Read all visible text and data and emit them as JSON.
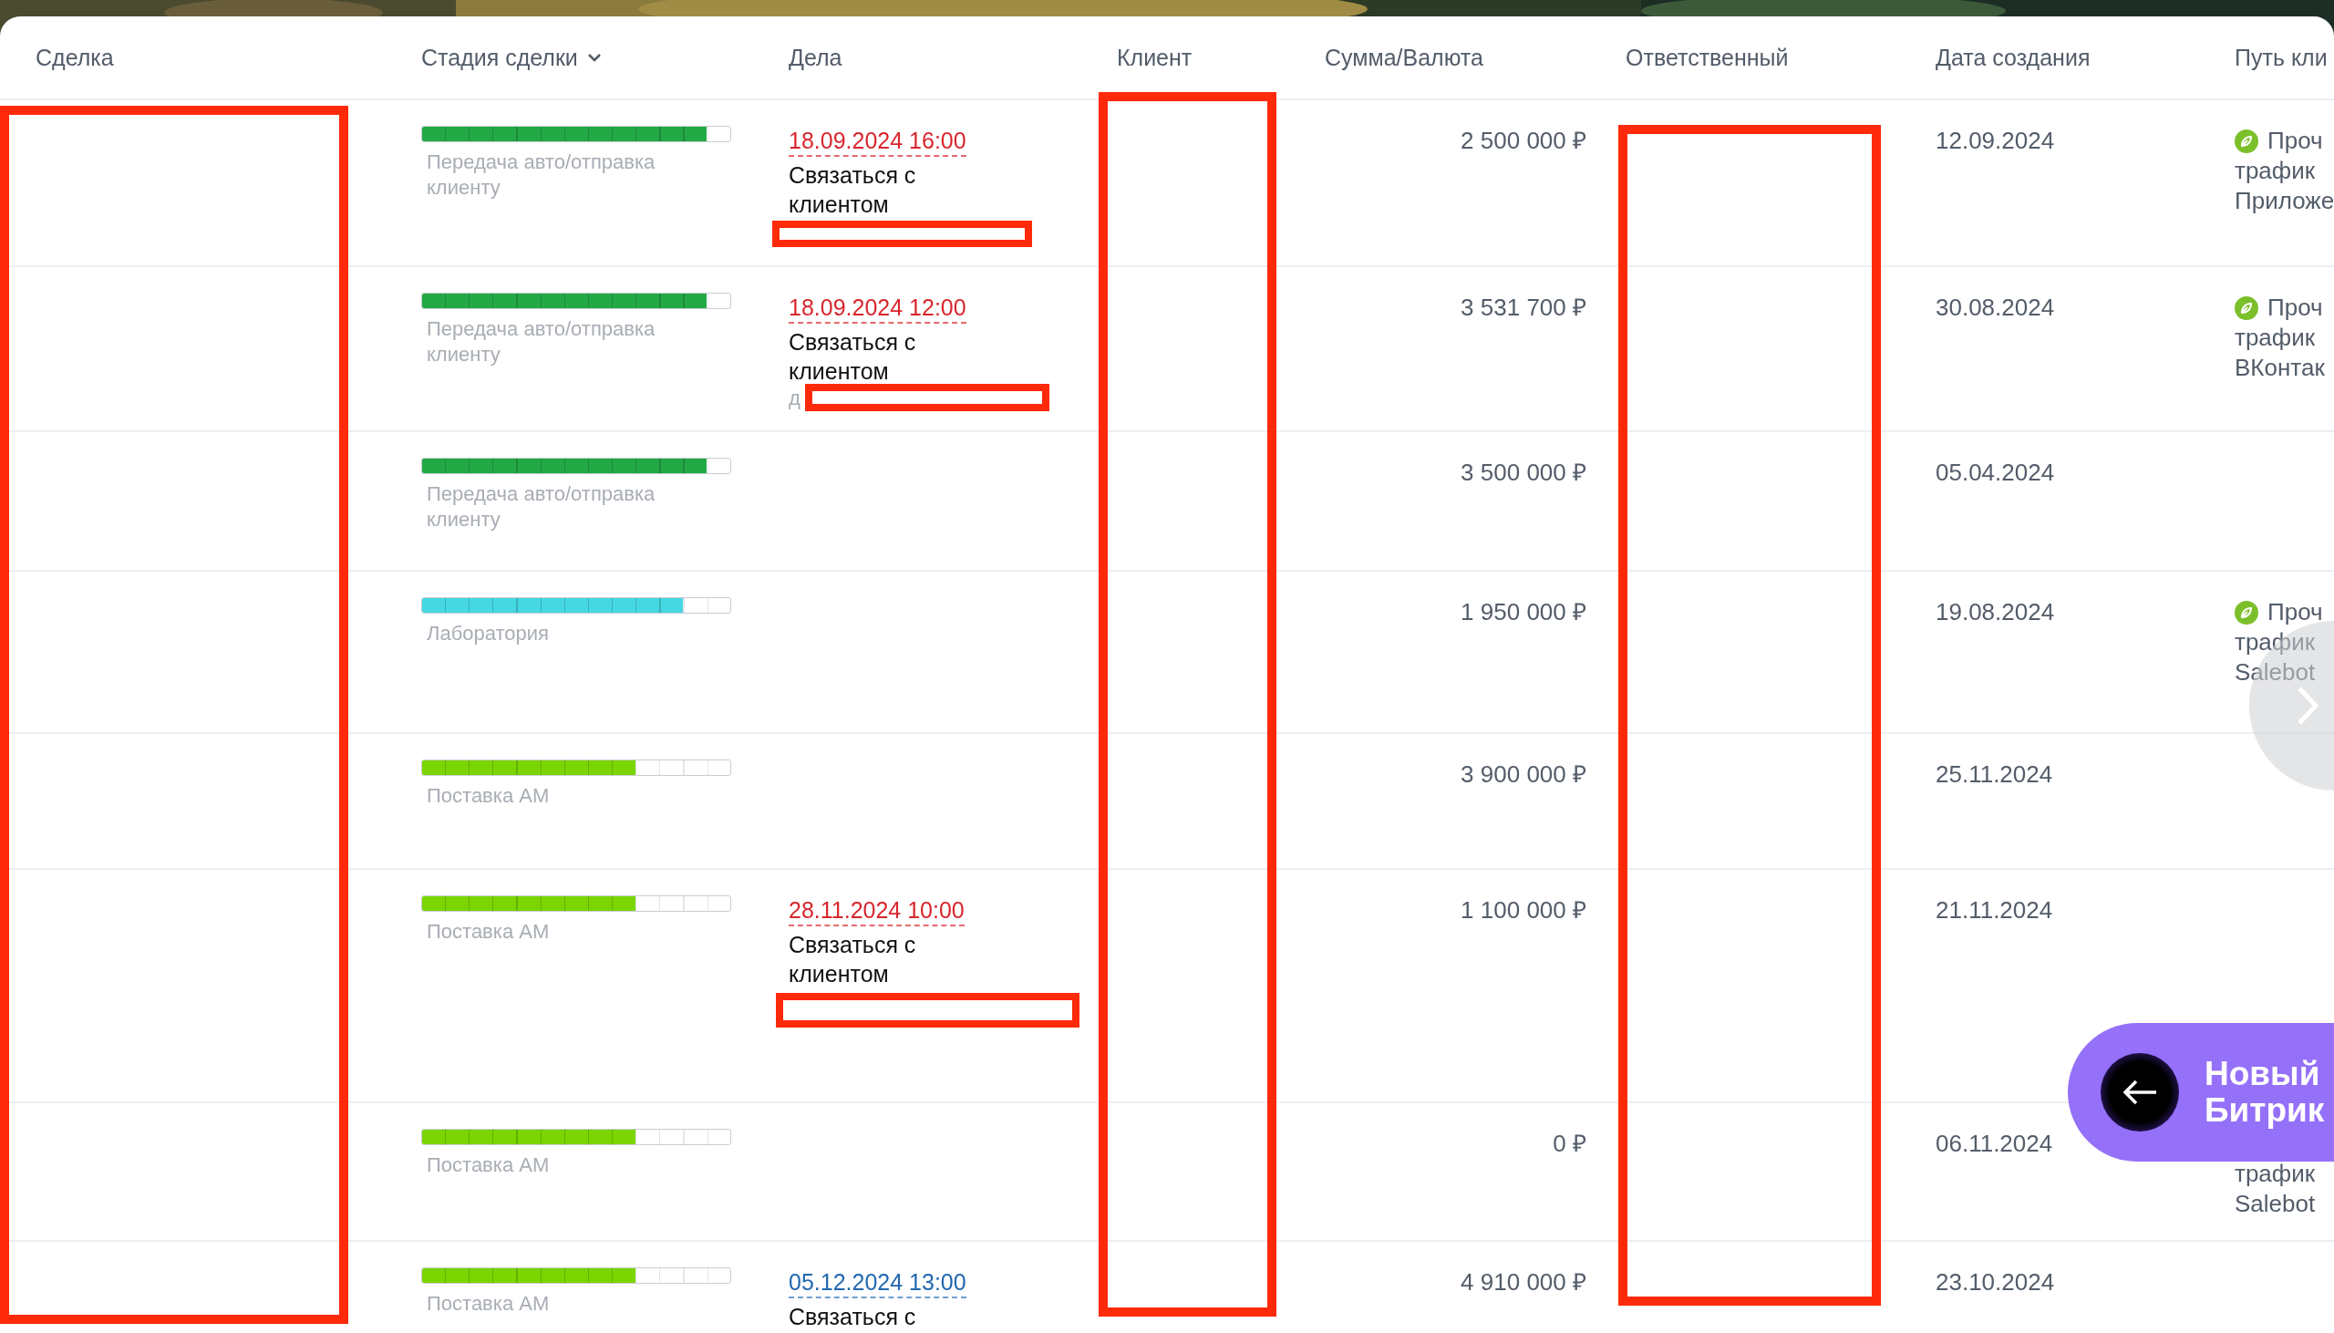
{
  "columns": [
    {
      "label": "Сделка"
    },
    {
      "label": "Стадия сделки",
      "sortable": true
    },
    {
      "label": "Дела"
    },
    {
      "label": "Клиент"
    },
    {
      "label": "Сумма/Валюта"
    },
    {
      "label": "Ответственный"
    },
    {
      "label": "Дата создания"
    },
    {
      "label": "Путь кли"
    }
  ],
  "rows": [
    {
      "stage": {
        "label": "Передача авто/отправка клиенту",
        "level": 0.923,
        "color": "#22a946"
      },
      "activity": {
        "date": "18.09.2024 16:00",
        "overdue": true,
        "title": "Связаться с клиентом"
      },
      "amount": "2 500 000 ₽",
      "created": "12.09.2024",
      "path": {
        "icon": true,
        "lines": [
          "Проч",
          "трафик",
          "Приложе"
        ]
      }
    },
    {
      "stage": {
        "label": "Передача авто/отправка клиенту",
        "level": 0.923,
        "color": "#22a946"
      },
      "activity": {
        "date": "18.09.2024 12:00",
        "overdue": true,
        "title": "Связаться с клиентом",
        "note": "д"
      },
      "amount": "3 531 700 ₽",
      "created": "30.08.2024",
      "path": {
        "icon": true,
        "lines": [
          "Проч",
          "трафик",
          "ВКонтак"
        ]
      }
    },
    {
      "stage": {
        "label": "Передача авто/отправка клиенту",
        "level": 0.923,
        "color": "#22a946"
      },
      "amount": "3 500 000 ₽",
      "created": "05.04.2024"
    },
    {
      "stage": {
        "label": "Лаборатория",
        "level": 0.846,
        "color": "#45d8e2"
      },
      "amount": "1 950 000 ₽",
      "created": "19.08.2024",
      "path": {
        "icon": true,
        "lines": [
          "Проч",
          "трафик",
          "Salebot"
        ]
      }
    },
    {
      "stage": {
        "label": "Поставка АМ",
        "level": 0.692,
        "color": "#7bd500"
      },
      "amount": "3 900 000 ₽",
      "created": "25.11.2024"
    },
    {
      "stage": {
        "label": "Поставка АМ",
        "level": 0.692,
        "color": "#7bd500"
      },
      "activity": {
        "date": "28.11.2024 10:00",
        "overdue": true,
        "title": "Связаться с клиентом"
      },
      "amount": "1 100 000 ₽",
      "created": "21.11.2024"
    },
    {
      "stage": {
        "label": "Поставка АМ",
        "level": 0.692,
        "color": "#7bd500"
      },
      "amount": "0 ₽",
      "created": "06.11.2024",
      "path": {
        "icon": false,
        "lines": [
          "трафик",
          "Salebot"
        ]
      }
    },
    {
      "stage": {
        "label": "Поставка АМ",
        "level": 0.692,
        "color": "#7bd500"
      },
      "activity": {
        "date": "05.12.2024 13:00",
        "overdue": false,
        "title": "Связаться с"
      },
      "amount": "4 910 000 ₽",
      "created": "23.10.2024"
    }
  ],
  "banner": {
    "text": "Новый Битрик"
  }
}
